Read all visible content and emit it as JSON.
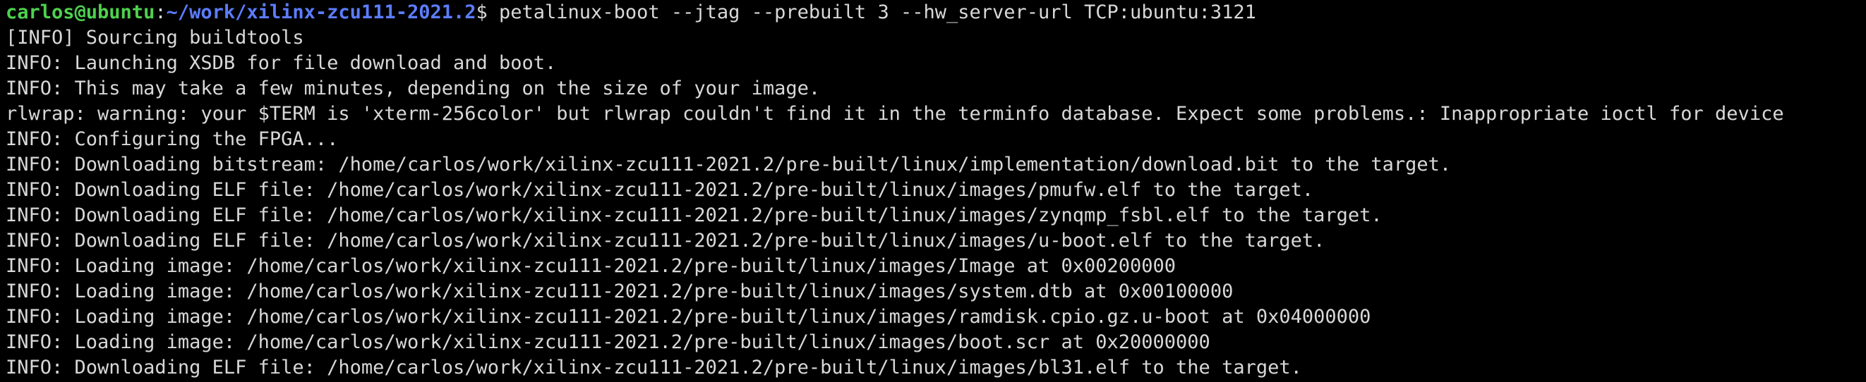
{
  "prompt": {
    "user_host": "carlos@ubuntu",
    "colon": ":",
    "cwd": "~/work/xilinx-zcu111-2021.2",
    "symbol": "$ ",
    "command": "petalinux-boot --jtag --prebuilt 3 --hw_server-url TCP:ubuntu:3121"
  },
  "output_lines": [
    "[INFO] Sourcing buildtools",
    "INFO: Launching XSDB for file download and boot.",
    "INFO: This may take a few minutes, depending on the size of your image.",
    "rlwrap: warning: your $TERM is 'xterm-256color' but rlwrap couldn't find it in the terminfo database. Expect some problems.: Inappropriate ioctl for device",
    "INFO: Configuring the FPGA...",
    "INFO: Downloading bitstream: /home/carlos/work/xilinx-zcu111-2021.2/pre-built/linux/implementation/download.bit to the target.",
    "INFO: Downloading ELF file: /home/carlos/work/xilinx-zcu111-2021.2/pre-built/linux/images/pmufw.elf to the target.",
    "INFO: Downloading ELF file: /home/carlos/work/xilinx-zcu111-2021.2/pre-built/linux/images/zynqmp_fsbl.elf to the target.",
    "INFO: Downloading ELF file: /home/carlos/work/xilinx-zcu111-2021.2/pre-built/linux/images/u-boot.elf to the target.",
    "INFO: Loading image: /home/carlos/work/xilinx-zcu111-2021.2/pre-built/linux/images/Image at 0x00200000",
    "INFO: Loading image: /home/carlos/work/xilinx-zcu111-2021.2/pre-built/linux/images/system.dtb at 0x00100000",
    "INFO: Loading image: /home/carlos/work/xilinx-zcu111-2021.2/pre-built/linux/images/ramdisk.cpio.gz.u-boot at 0x04000000",
    "INFO: Loading image: /home/carlos/work/xilinx-zcu111-2021.2/pre-built/linux/images/boot.scr at 0x20000000",
    "INFO: Downloading ELF file: /home/carlos/work/xilinx-zcu111-2021.2/pre-built/linux/images/bl31.elf to the target."
  ],
  "colors": {
    "background": "#000000",
    "text": "#d8d8d8",
    "user_host": "#4ed24e",
    "path": "#5c7dff"
  }
}
